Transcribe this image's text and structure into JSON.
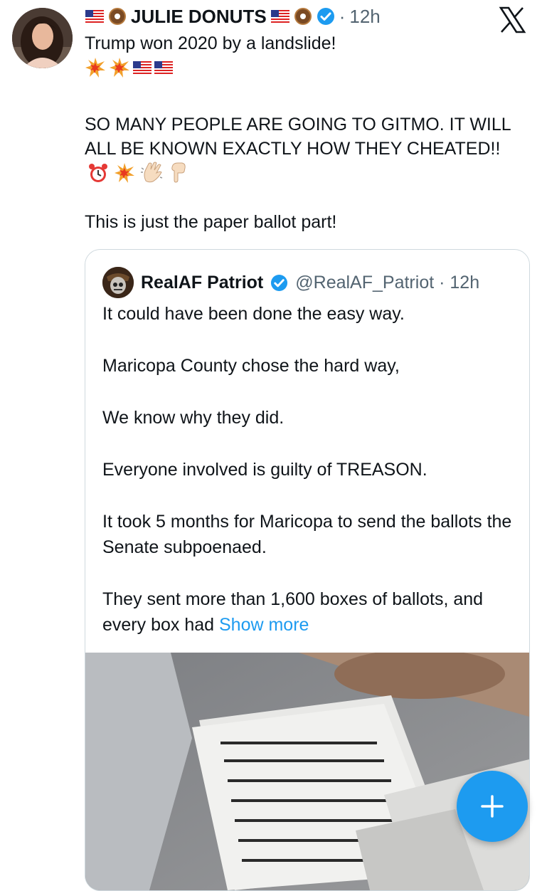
{
  "post": {
    "author_name": "JULIE DONUTS",
    "separator": "·",
    "time": "12h",
    "line1": "Trump won 2020 by a landslide!",
    "line2": "SO MANY PEOPLE ARE GOING TO GITMO. IT WILL ALL BE KNOWN EXACTLY HOW THEY CHEATED!!",
    "line3": "This is just the paper ballot part!",
    "icons": [
      "flag-icon",
      "donut-icon",
      "verified-badge-icon",
      "x-logo-icon",
      "collision-icon",
      "alarm-clock-icon",
      "waving-hand-icon",
      "pointing-down-icon"
    ]
  },
  "quote": {
    "author_name": "RealAF Patriot",
    "handle_time": "@RealAF_Patriot · 12h",
    "paragraphs": [
      "It could have been done the easy way.",
      "Maricopa County chose the hard way,",
      "We know why they did.",
      "Everyone involved is guilty of TREASON.",
      "It took 5 months for Maricopa to send the ballots the Senate subpoenaed.",
      "They sent more than 1,600 boxes of ballots, and every box had"
    ],
    "show_more": "Show more"
  },
  "fab": {
    "label": "+"
  },
  "colors": {
    "accent": "#1d9bf0",
    "text": "#0f1419",
    "muted": "#536471",
    "border": "#cfd9de"
  }
}
